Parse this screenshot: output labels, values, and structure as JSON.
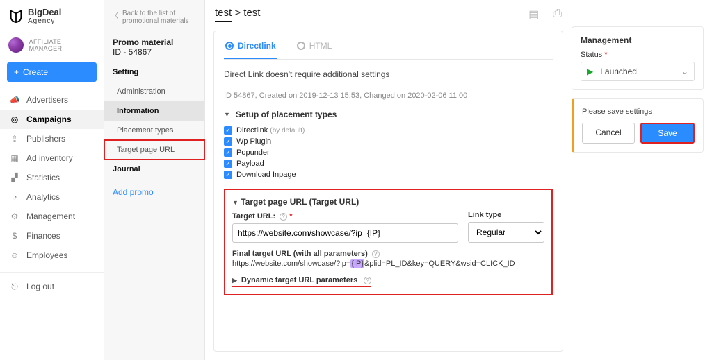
{
  "brand": {
    "line1": "BigDeal",
    "line2": "Agency"
  },
  "role": "AFFILIATE MANAGER",
  "create_btn": "Create",
  "nav": {
    "advertisers": "Advertisers",
    "campaigns": "Campaigns",
    "publishers": "Publishers",
    "adinventory": "Ad inventory",
    "statistics": "Statistics",
    "analytics": "Analytics",
    "management": "Management",
    "finances": "Finances",
    "employees": "Employees",
    "logout": "Log out"
  },
  "back": "Back to the list of promotional materials",
  "pm": {
    "title": "Promo material",
    "id": "ID - 54867"
  },
  "snav": {
    "setting": "Setting",
    "administration": "Administration",
    "information": "Information",
    "placement": "Placement types",
    "target": "Target page URL",
    "journal": "Journal"
  },
  "add_promo": "Add promo",
  "breadcrumb": {
    "a": "test",
    "b": "test"
  },
  "tabs": {
    "directlink": "Directlink",
    "html": "HTML"
  },
  "note": "Direct Link doesn't require additional settings",
  "meta": "ID 54867, Created on 2019-12-13 15:53, Changed on 2020-02-06 11:00",
  "placement": {
    "title": "Setup of placement types",
    "items": [
      "Directlink",
      "Wp Plugin",
      "Popunder",
      "Payload",
      "Download Inpage"
    ],
    "default": "(by default)"
  },
  "target": {
    "title": "Target page URL (Target URL)",
    "url_label": "Target URL:",
    "url_value": "https://website.com/showcase/?ip={IP}",
    "linktype_label": "Link type",
    "linktype_value": "Regular",
    "final_label": "Final target URL (with all parameters)",
    "final_pre": "https://website.com/showcase/?ip=",
    "final_hl": "{IP}",
    "final_post": "&plid=PL_ID&key=QUERY&wsid=CLICK_ID",
    "dyn": "Dynamic target URL parameters"
  },
  "mgmt": {
    "title": "Management",
    "status_label": "Status",
    "status_value": "Launched"
  },
  "save": {
    "msg": "Please save settings",
    "cancel": "Cancel",
    "save": "Save"
  }
}
